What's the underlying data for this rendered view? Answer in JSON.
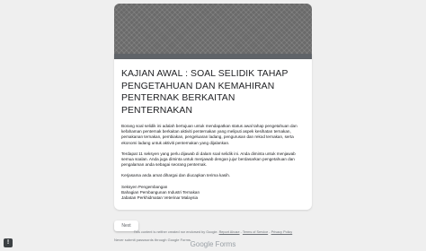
{
  "form": {
    "title": "KAJIAN AWAL : SOAL SELIDIK TAHAP PENGETAHUAN DAN KEMAHIRAN PENTERNAK BERKAITAN PENTERNAKAN",
    "description": [
      "Borang soal selidik ini adalah bertujuan untuk mendapatkan status awal tahap pengetahuan dan kefahaman penternak berkaitan aktiviti penternakan yang meliputi aspek kesihatan ternakan, pemakanan ternakan, pembiakan, pengeluaran ladang, pengurusan dan rekod ternakan, serta ekonomi ladang untuk aktiviti penternakan yang dijalankan.",
      "Terdapat 11 seksyen yang perlu dijawab di dalam soal selidik ini. Anda diminta untuk menjawab semua soalan. Anda juga diminta untuk menjawab dengan jujur berdasarkan pengetahuan dan pengalaman anda sebagai seorang penternak.",
      "Kerjasama anda amat dihargai dan diucapkan terima kasih."
    ],
    "signature": [
      "Seksyen Pengembangan",
      "Bahagian Pembangunan Industri Ternakan",
      "Jabatan Perkhidmatan Veterinar Malaysia"
    ],
    "next_label": "Next",
    "never_submit": "Never submit passwords through Google Forms."
  },
  "footer": {
    "text": "This content is neither created nor endorsed by Google.",
    "report_abuse": "Report Abuse",
    "separator": " - ",
    "terms": "Terms of Service",
    "privacy": "Privacy Policy",
    "logo_text": "Google Forms"
  },
  "report_icon_symbol": "!"
}
